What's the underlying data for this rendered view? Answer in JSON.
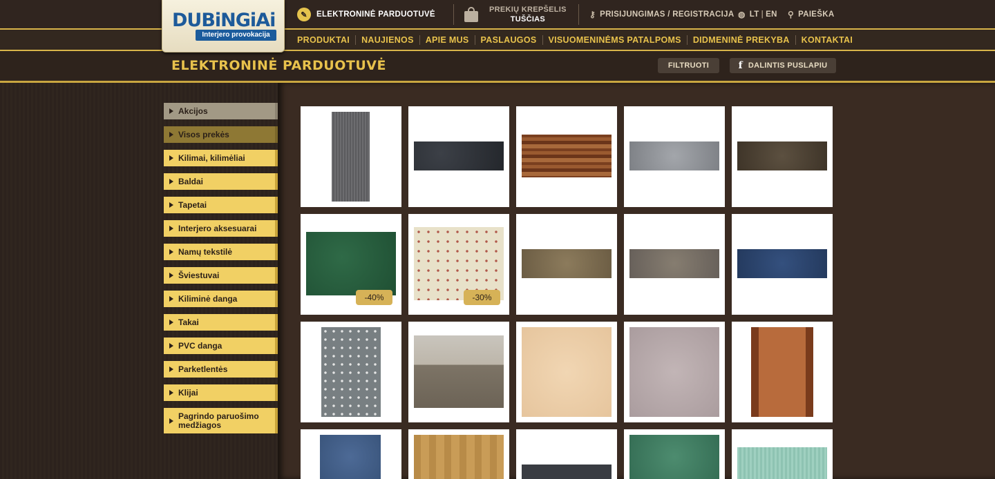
{
  "brand": {
    "name": "DUBiNGiAi",
    "tagline": "Interjero provokacija"
  },
  "topbar": {
    "shop_label": "ELEKTRONINĖ PARDUOTUVĖ",
    "cart_title": "PREKIŲ KREPŠELIS",
    "cart_status": "TUŠČIAS",
    "login_label": "PRISIJUNGIMAS / REGISTRACIJA",
    "lang_lt": "LT",
    "lang_en": "EN",
    "search_label": "PAIEŠKA",
    "icons": {
      "shop": "tag-icon",
      "cart": "shopping-bag-icon",
      "login": "key-icon",
      "lang": "globe-icon",
      "search": "magnifier-icon"
    }
  },
  "nav": [
    "PRODUKTAI",
    "NAUJIENOS",
    "APIE MUS",
    "PASLAUGOS",
    "VISUOMENINĖMS PATALPOMS",
    "DIDMENINĖ PREKYBA",
    "KONTAKTAI"
  ],
  "page": {
    "title": "ELEKTRONINĖ PARDUOTUVĖ",
    "filter_label": "FILTRUOTI",
    "share_label": "DALINTIS PUSLAPIU"
  },
  "sidebar": [
    "Akcijos",
    "Visos prekės",
    "Kilimai, kilimėliai",
    "Baldai",
    "Tapetai",
    "Interjero aksesuarai",
    "Namų tekstilė",
    "Šviestuvai",
    "Kiliminė danga",
    "Takai",
    "PVC danga",
    "Parketlentės",
    "Klijai",
    "Pagrindo paruošimo medžiagos"
  ],
  "colors": {
    "accent_gold": "#e8c24c",
    "sidebar_item": "#f1d064",
    "sidebar_active": "#8e7834",
    "background": "#2b211c",
    "discount_badge": "#d6b257"
  },
  "products": [
    {
      "name": "grey-ribbed-runner",
      "discount": ""
    },
    {
      "name": "dark-grey-carpet",
      "discount": ""
    },
    {
      "name": "walnut-parquet",
      "discount": ""
    },
    {
      "name": "light-grey-carpet",
      "discount": ""
    },
    {
      "name": "brown-carpet",
      "discount": ""
    },
    {
      "name": "green-carpet",
      "discount": "-40%"
    },
    {
      "name": "beige-dotted-rug",
      "discount": "-30%"
    },
    {
      "name": "sand-carpet",
      "discount": ""
    },
    {
      "name": "taupe-carpet",
      "discount": ""
    },
    {
      "name": "blue-carpet",
      "discount": ""
    },
    {
      "name": "grey-heart-rug",
      "discount": ""
    },
    {
      "name": "room-carpet-photo",
      "discount": ""
    },
    {
      "name": "peach-pvc",
      "discount": ""
    },
    {
      "name": "lilac-pvc",
      "discount": ""
    },
    {
      "name": "patterned-runner",
      "discount": ""
    },
    {
      "name": "blue-rug",
      "discount": ""
    },
    {
      "name": "oak-laminate",
      "discount": ""
    },
    {
      "name": "charcoal-carpet",
      "discount": ""
    },
    {
      "name": "green-shag",
      "discount": ""
    },
    {
      "name": "mint-carpet",
      "discount": ""
    }
  ]
}
